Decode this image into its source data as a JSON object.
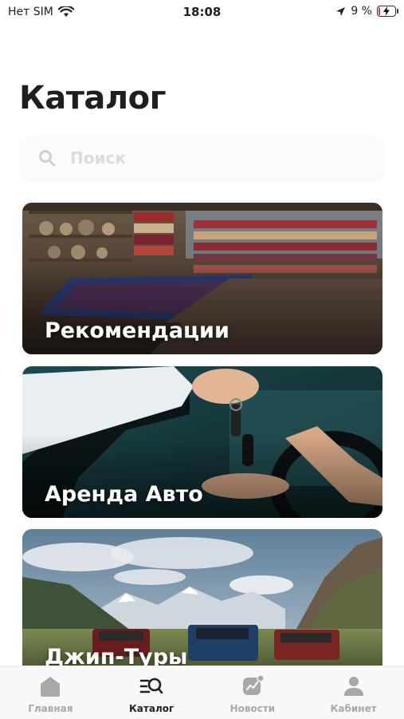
{
  "status_bar": {
    "carrier": "Нет SIM",
    "time": "18:08",
    "battery_percent": "9 %",
    "battery_level": 0.09
  },
  "page_title": "Каталог",
  "search": {
    "placeholder": "Поиск"
  },
  "cards": [
    {
      "label": "Рекомендации"
    },
    {
      "label": "Аренда Авто"
    },
    {
      "label": "Джип-Туры"
    }
  ],
  "tab_bar": {
    "items": [
      {
        "label": "Главная",
        "icon": "home-icon",
        "active": false
      },
      {
        "label": "Каталог",
        "icon": "catalog-search-icon",
        "active": true
      },
      {
        "label": "Новости",
        "icon": "news-chart-icon",
        "active": false
      },
      {
        "label": "Кабинет",
        "icon": "user-icon",
        "active": false
      }
    ]
  },
  "colors": {
    "active_tab": "#1f1f1f",
    "inactive_tab": "#a8a8a8",
    "battery_low": "#e23b3b"
  }
}
